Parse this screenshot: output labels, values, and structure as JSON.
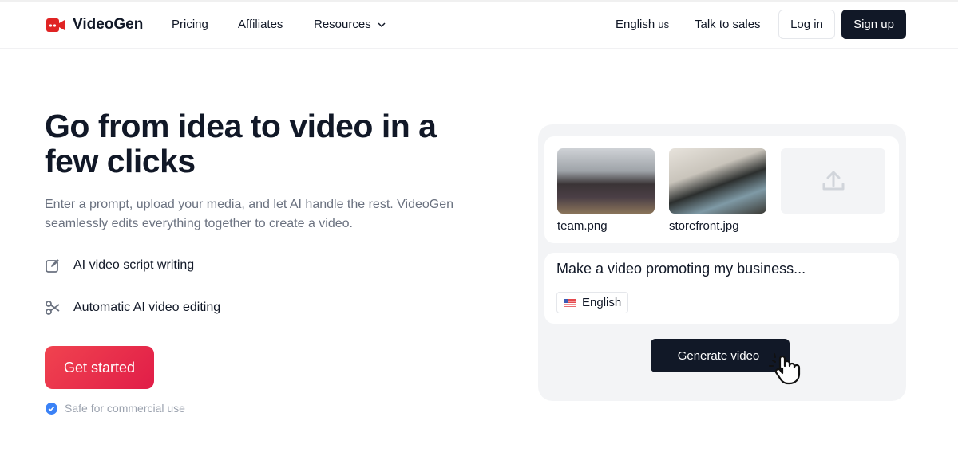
{
  "header": {
    "brand": "VideoGen",
    "nav": [
      "Pricing",
      "Affiliates",
      "Resources"
    ],
    "language": "English",
    "language_region": "us",
    "talk_to_sales": "Talk to sales",
    "login": "Log in",
    "signup": "Sign up"
  },
  "hero": {
    "title": "Go from idea to video in a few clicks",
    "subtitle": "Enter a prompt, upload your media, and let AI handle the rest. VideoGen seamlessly edits everything together to create a video.",
    "features": [
      "AI video script writing",
      "Automatic AI video editing"
    ],
    "cta": "Get started",
    "safe": "Safe for commercial use"
  },
  "demo": {
    "files": [
      "team.png",
      "storefront.jpg"
    ],
    "prompt": "Make a video promoting my business...",
    "language": "English",
    "generate": "Generate video"
  },
  "colors": {
    "accent": "#e11d48",
    "dark": "#111827",
    "check": "#3b82f6"
  }
}
